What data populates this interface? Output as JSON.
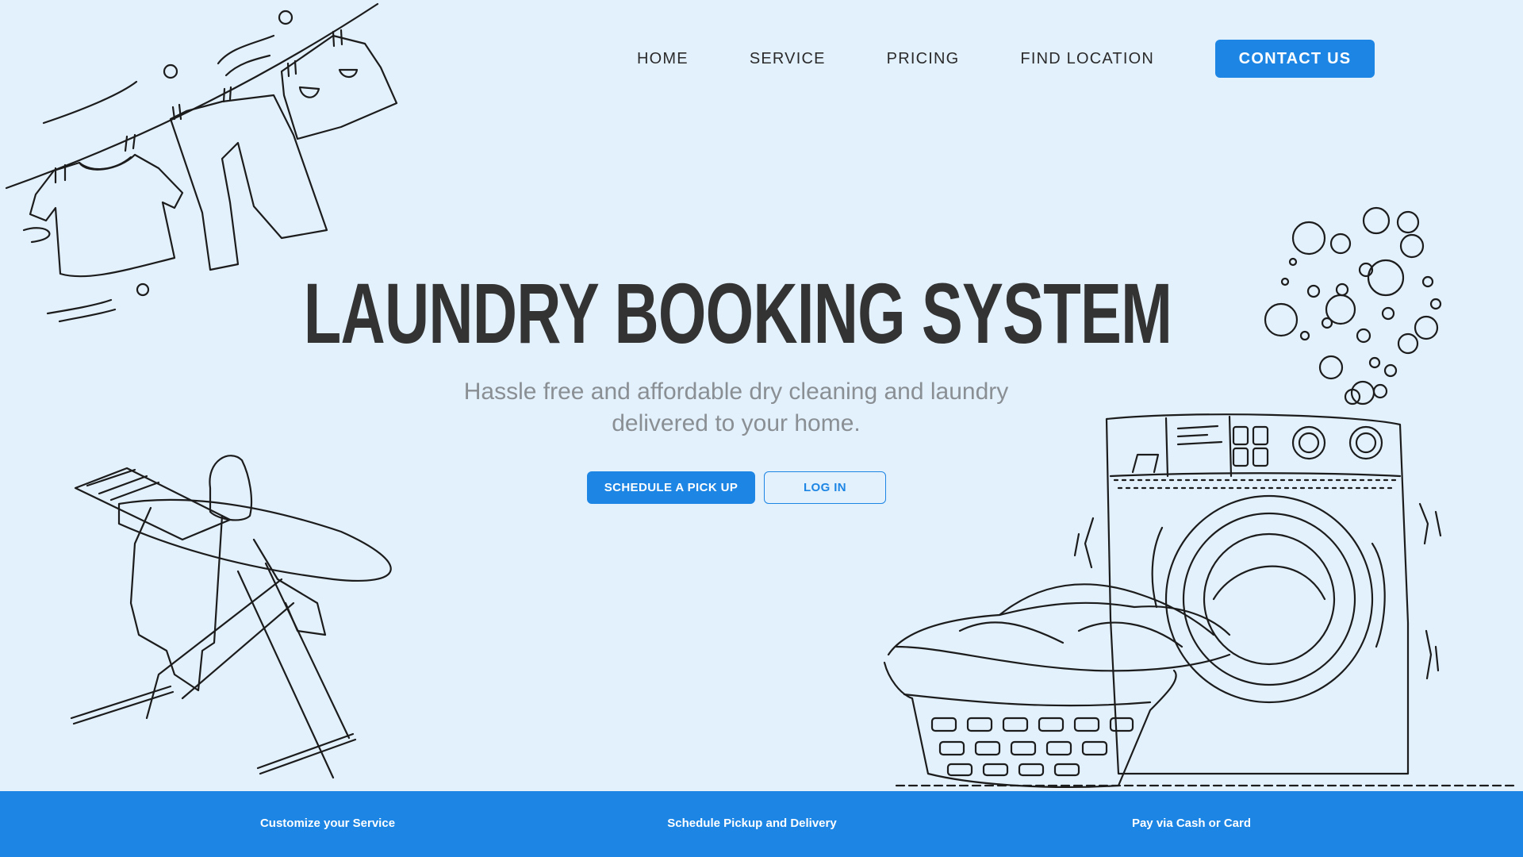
{
  "nav": {
    "items": [
      {
        "label": "HOME"
      },
      {
        "label": "SERVICE"
      },
      {
        "label": "PRICING"
      },
      {
        "label": "FIND LOCATION"
      }
    ],
    "contact_label": "CONTACT  US"
  },
  "hero": {
    "title": "LAUNDRY BOOKING SYSTEM",
    "subtitle": "Hassle free and affordable dry cleaning and laundry delivered to your home.",
    "primary_button": "SCHEDULE A PICK UP",
    "secondary_button": "LOG IN"
  },
  "features": {
    "items": [
      {
        "label": "Customize your Service"
      },
      {
        "label": "Schedule Pickup and Delivery"
      },
      {
        "label": "Pay via Cash or Card"
      }
    ]
  },
  "illustrations": {
    "clothesline": "clothesline-illustration",
    "ironing_board": "ironing-board-illustration",
    "washing_machine": "washing-machine-illustration",
    "laundry_basket": "laundry-basket-illustration",
    "bubbles": "soap-bubbles-illustration"
  },
  "colors": {
    "background": "#e3f1fd",
    "accent": "#1d85e3",
    "title": "#333333",
    "subtitle": "#8a8f94"
  }
}
